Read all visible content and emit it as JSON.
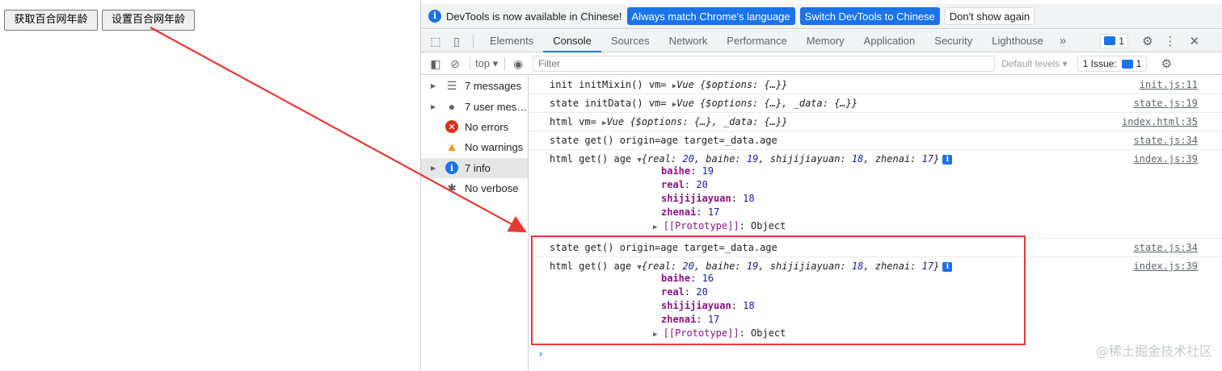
{
  "page": {
    "get_button": "获取百合网年龄",
    "set_button": "设置百合网年龄"
  },
  "infobar": {
    "text": "DevTools is now available in Chinese!",
    "btn_match": "Always match Chrome's language",
    "btn_switch": "Switch DevTools to Chinese",
    "btn_dismiss": "Don't show again"
  },
  "tabs": [
    "Elements",
    "Console",
    "Sources",
    "Network",
    "Performance",
    "Memory",
    "Application",
    "Security",
    "Lighthouse"
  ],
  "tabs_more": "»",
  "message_badge_count": "1",
  "toolbar": {
    "context": "top",
    "filter_placeholder": "Filter",
    "levels": "Default levels",
    "issue_label": "1 Issue:",
    "issue_count": "1"
  },
  "sidebar": [
    {
      "label": "7 messages",
      "icon": "list-icon",
      "expandable": true
    },
    {
      "label": "7 user mes…",
      "icon": "user-icon",
      "expandable": true
    },
    {
      "label": "No errors",
      "icon": "error-icon",
      "expandable": false
    },
    {
      "label": "No warnings",
      "icon": "warning-icon",
      "expandable": false
    },
    {
      "label": "7 info",
      "icon": "info-icon",
      "expandable": true,
      "active": true
    },
    {
      "label": "No verbose",
      "icon": "bug-icon",
      "expandable": false
    }
  ],
  "logs": {
    "l1": {
      "text": "init initMixin() vm= ",
      "obj": "Vue {$options: {…}}",
      "src": "init.js:11"
    },
    "l2": {
      "text": "state initData() vm= ",
      "obj": "Vue {$options: {…}, _data: {…}}",
      "src": "state.js:19"
    },
    "l3": {
      "text": "html vm= ",
      "obj": "Vue {$options: {…}, _data: {…}}",
      "src": "index.html:35"
    },
    "l4": {
      "text": "state get() origin=age target=_data.age",
      "src": "state.js:34"
    },
    "l5": {
      "text": "html get() age ",
      "obj_prefix": "{real: ",
      "src": "index.js:39",
      "summary": {
        "real": "20",
        "baihe": "19",
        "shijijiayuan": "18",
        "zhenai": "17"
      },
      "props": [
        [
          "baihe",
          "19"
        ],
        [
          "real",
          "20"
        ],
        [
          "shijijiayuan",
          "18"
        ],
        [
          "zhenai",
          "17"
        ]
      ]
    },
    "l6": {
      "text": "state get() origin=age target=_data.age",
      "src": "state.js:34"
    },
    "l7": {
      "text": "html get() age ",
      "src": "index.js:39",
      "summary": {
        "real": "20",
        "baihe": "19",
        "shijijiayuan": "18",
        "zhenai": "17"
      },
      "props": [
        [
          "baihe",
          "16"
        ],
        [
          "real",
          "20"
        ],
        [
          "shijijiayuan",
          "18"
        ],
        [
          "zhenai",
          "17"
        ]
      ]
    },
    "proto_label": "[[Prototype]]",
    "proto_value": "Object"
  },
  "prompt": "›",
  "watermark": "@稀土掘金技术社区",
  "colors": {
    "accent": "#1a73e8",
    "highlight": "#e53935",
    "prop_name": "#881280",
    "number": "#1a1aa6"
  }
}
